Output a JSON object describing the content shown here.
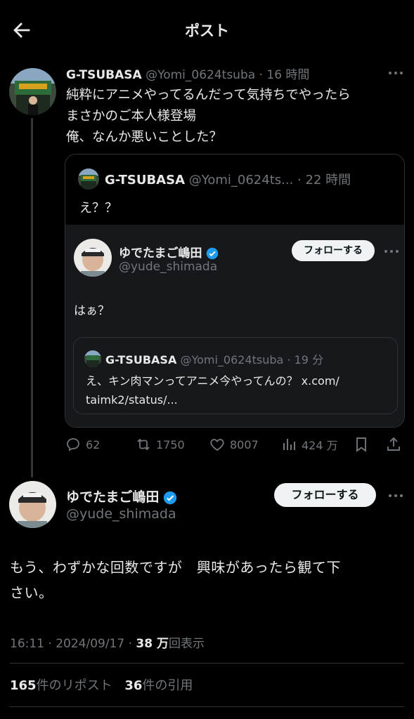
{
  "header": {
    "title": "ポスト"
  },
  "reply_tweet": {
    "display_name": "G-TSUBASA",
    "handle": "@Yomi_0624tsuba",
    "sep": "·",
    "time": "16 時間",
    "lines": [
      "純粋にアニメやってるんだって気持ちでやったら",
      "まさかのご本人様登場",
      "俺、なんか悪いことした？"
    ]
  },
  "quoted": {
    "display_name": "G-TSUBASA",
    "handle": "@Yomi_0624ts...",
    "sep": "·",
    "time": "22 時間",
    "text": "え？？"
  },
  "inner_quote": {
    "display_name": "ゆでたまご嶋田",
    "handle": "@yude_shimada",
    "follow_label": "フォローする",
    "text": "はぁ？"
  },
  "nested_quote": {
    "display_name": "G-TSUBASA",
    "handle": "@Yomi_0624tsuba",
    "sep": "·",
    "time": "19 分",
    "line1": "え、キン肉マンってアニメ今やってんの？ x.com/",
    "line2": "taimk2/status/..."
  },
  "actions": {
    "replies": "62",
    "reposts": "1750",
    "likes": "8007",
    "views": "424 万"
  },
  "main_tweet": {
    "display_name": "ゆでたまご嶋田",
    "handle": "@yude_shimada",
    "follow_label": "フォローする",
    "lines": [
      "もう、わずかな回数ですが　興味があったら観て下",
      "さい。"
    ],
    "timestamp": "16:11 · 2024/09/17 · ",
    "view_count": "38 万",
    "view_label": "回表示"
  },
  "stats": {
    "reposts_count": "165",
    "reposts_label": "件のリポスト",
    "quotes_count": "36",
    "quotes_label": "件の引用"
  },
  "colors": {
    "verified": "#1d9bf0",
    "muted": "#71767b",
    "divider": "#2f3336"
  }
}
